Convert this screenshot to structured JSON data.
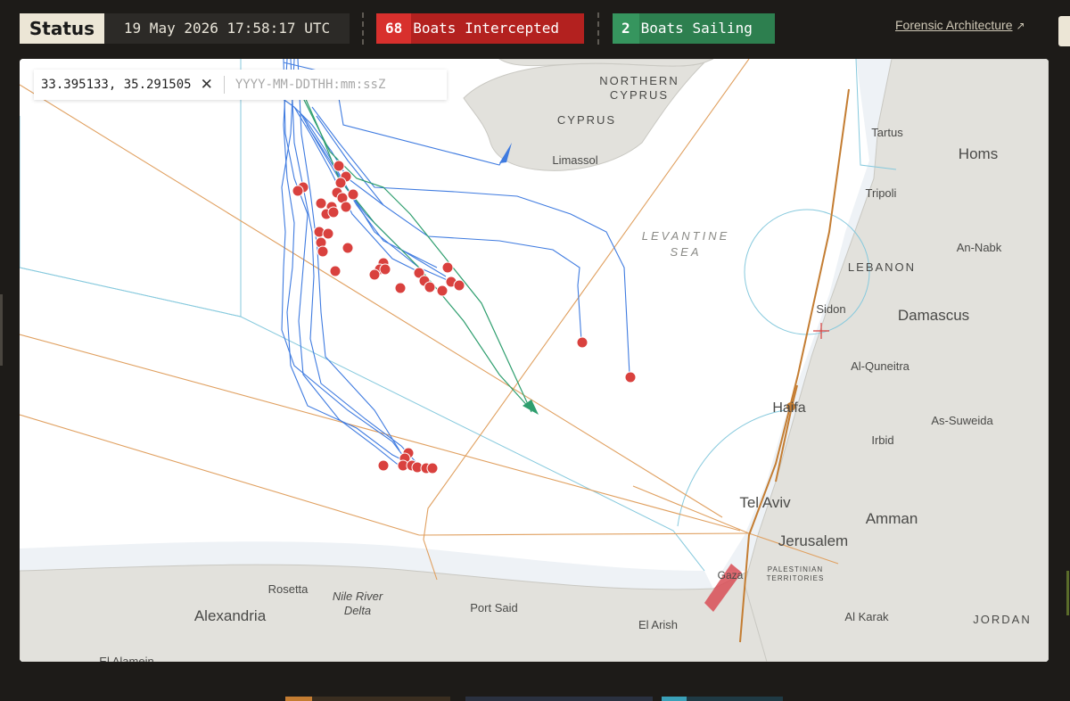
{
  "header": {
    "status_label": "Status",
    "timestamp": "19 May 2026 17:58:17 UTC",
    "intercepted": {
      "count": "68",
      "label": "Boats Intercepted",
      "color": "#d8302d"
    },
    "sailing": {
      "count": "2",
      "label": "Boats Sailing",
      "color": "#36955e"
    },
    "source_link": "Forensic Architecture",
    "source_link_icon": "arrow-up-right-icon"
  },
  "coordinate_panel": {
    "coordinates": "33.395133, 35.291505",
    "clear_icon": "close-icon",
    "date_placeholder": "YYYY-MM-DDTHH:mm:ssZ"
  },
  "map": {
    "colors": {
      "land": "#e2e1dc",
      "sea": "#ffffff",
      "shore_band": "#eef2f6",
      "boat_track": "#3f7be0",
      "active_track": "#2e9e6e",
      "flight_path": "#e0a060",
      "boundary": "#86c9dd",
      "intercept": "#d9413e",
      "gaza": "#d84d56"
    },
    "seas": [
      {
        "name": "LEVANTINE",
        "name2": "SEA"
      }
    ],
    "labels": {
      "northern_cyprus_1": "NORTHERN",
      "northern_cyprus_2": "CYPRUS",
      "cyprus": "CYPRUS",
      "limassol": "Limassol",
      "tartus": "Tartus",
      "homs": "Homs",
      "tripoli": "Tripoli",
      "an_nabk": "An-Nabk",
      "lebanon": "LEBANON",
      "sidon": "Sidon",
      "damascus": "Damascus",
      "al_quneitra": "Al-Quneitra",
      "haifa": "Haifa",
      "as_suweida": "As-Suweida",
      "irbid": "Irbid",
      "tel_aviv": "Tel Aviv",
      "amman": "Amman",
      "jerusalem": "Jerusalem",
      "palestinian_1": "PALESTINIAN",
      "palestinian_2": "TERRITORIES",
      "gaza": "Gaza",
      "rosetta": "Rosetta",
      "nile_delta_1": "Nile River",
      "nile_delta_2": "Delta",
      "port_said": "Port Said",
      "alexandria": "Alexandria",
      "el_arish": "El Arish",
      "al_karak": "Al Karak",
      "jordan": "JORDAN",
      "el_alamein": "El Alamein"
    }
  }
}
